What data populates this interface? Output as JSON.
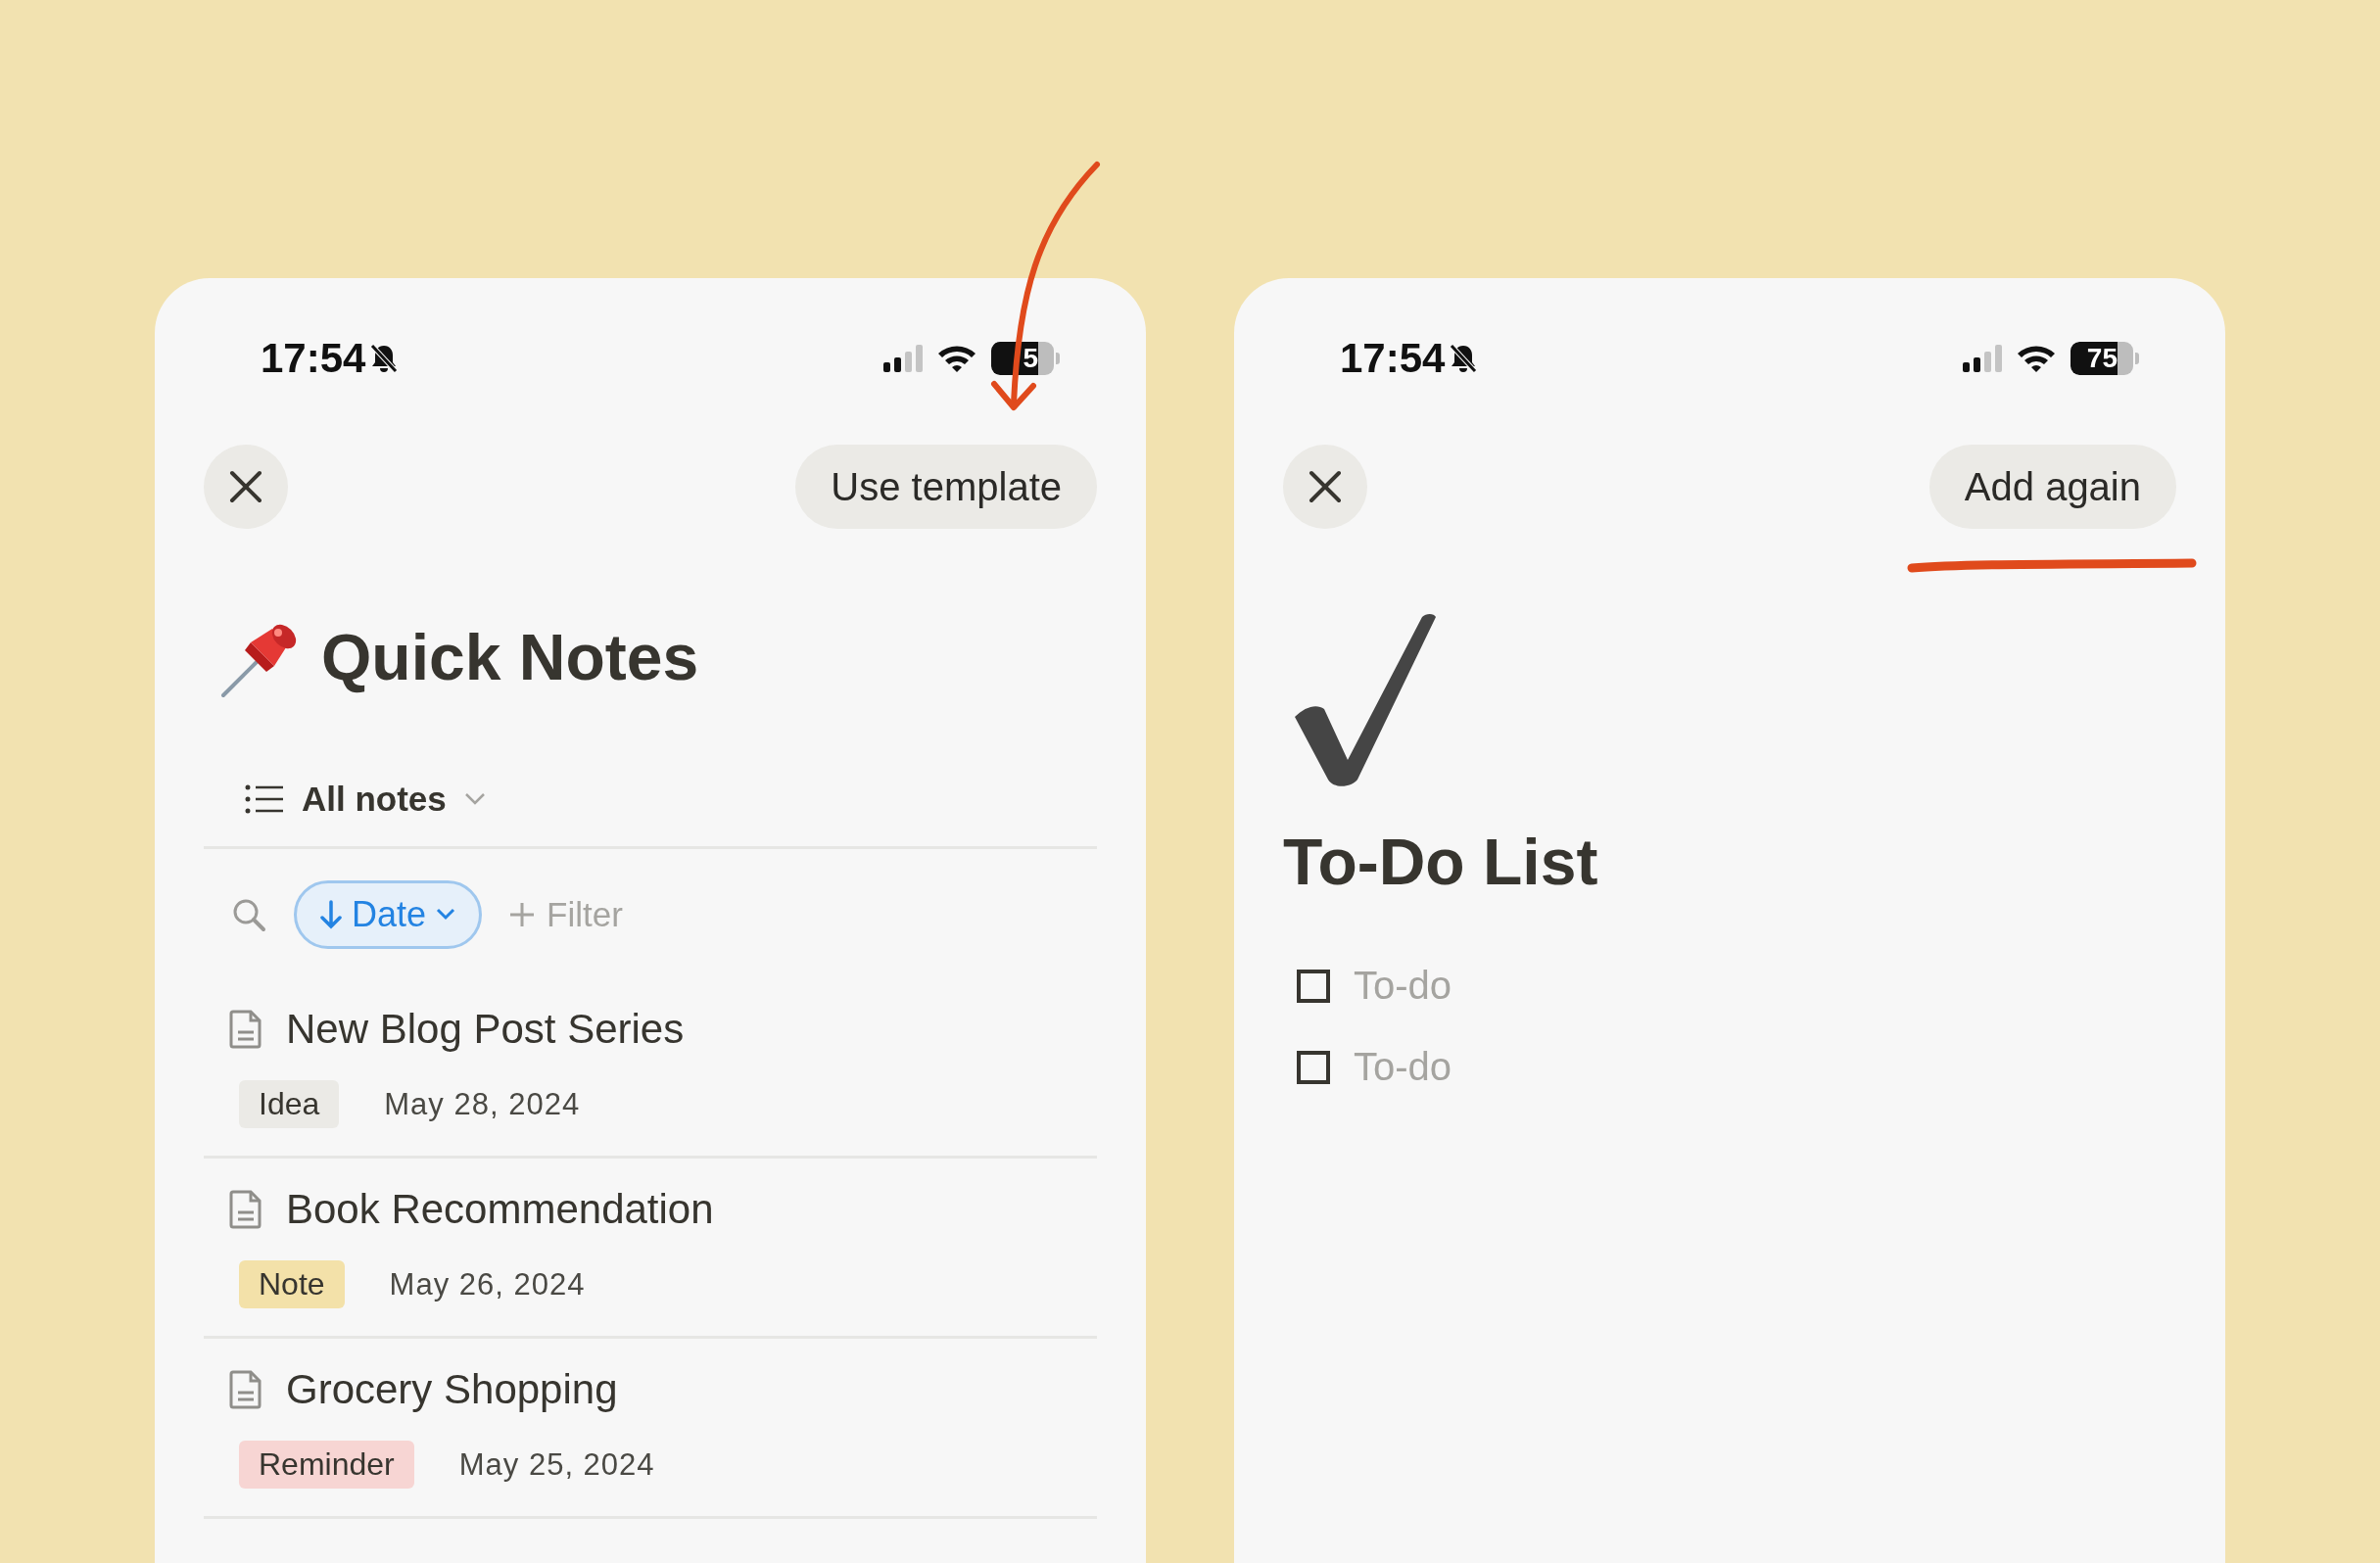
{
  "panels": [
    {
      "kind": "database",
      "status_bar": {
        "time": "17:54",
        "battery": "5"
      },
      "action_button": "Use template",
      "title": "Quick Notes",
      "view": {
        "label": "All notes"
      },
      "sort": {
        "label": "Date"
      },
      "filter": "Filter",
      "arrow_annotation": true,
      "notes": [
        {
          "title": "New Blog Post Series",
          "tag": {
            "label": "Idea",
            "color": "#ebeae6"
          },
          "date": "May 28, 2024"
        },
        {
          "title": "Book Recommendation",
          "tag": {
            "label": "Note",
            "color": "#f3e1a9"
          },
          "date": "May 26, 2024"
        },
        {
          "title": "Grocery Shopping",
          "tag": {
            "label": "Reminder",
            "color": "#f7d5d3"
          },
          "date": "May 25, 2024"
        }
      ]
    },
    {
      "kind": "page",
      "status_bar": {
        "time": "17:54",
        "battery": "75"
      },
      "action_button": "Add again",
      "title": "To-Do List",
      "underline_annotation": true,
      "todos": [
        {
          "text": "To-do",
          "checked": false
        },
        {
          "text": "To-do",
          "checked": false
        }
      ]
    }
  ]
}
